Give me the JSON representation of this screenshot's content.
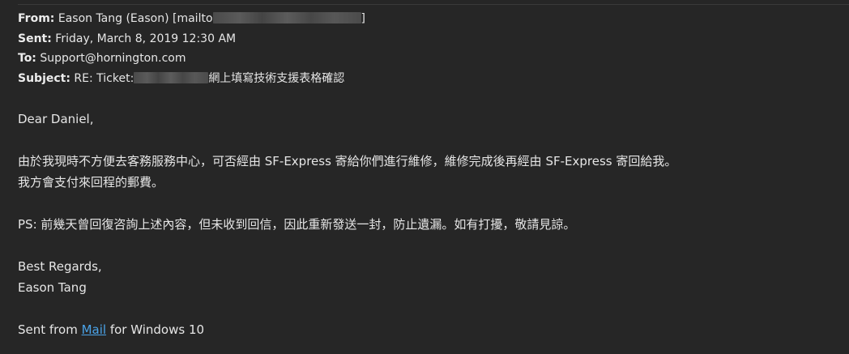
{
  "header": {
    "from_label": "From:",
    "from_value": "Eason Tang (Eason) [mailto",
    "from_suffix": "]",
    "sent_label": "Sent:",
    "sent_value": "Friday, March 8, 2019 12:30 AM",
    "to_label": "To:",
    "to_value": "Support@hornington.com",
    "subject_label": "Subject:",
    "subject_prefix": "RE: Ticket:",
    "subject_suffix": "網上填寫技術支援表格確認"
  },
  "body": {
    "greeting": "Dear Daniel,",
    "para1_line1": "由於我現時不方便去客務服務中心，可否經由 SF-Express 寄給你們進行維修，維修完成後再經由 SF-Express 寄回給我。",
    "para1_line2": "我方會支付來回程的郵費。",
    "ps_line": "PS: 前幾天曾回復咨詢上述內容，但未收到回信，因此重新發送一封，防止遺漏。如有打擾，敬請見諒。",
    "closing": "Best Regards,",
    "signature": "Eason Tang",
    "sent_from_prefix": "Sent from ",
    "sent_from_link": "Mail",
    "sent_from_suffix": " for Windows 10"
  }
}
